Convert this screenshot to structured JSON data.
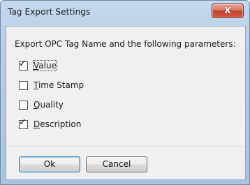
{
  "window": {
    "title": "Tag Export Settings",
    "close_glyph": "X"
  },
  "dialog": {
    "description": "Export OPC Tag Name and the following parameters:",
    "options": [
      {
        "label_prefix": "",
        "mnemonic": "V",
        "label_rest": "alue",
        "checked": true
      },
      {
        "label_prefix": "",
        "mnemonic": "T",
        "label_rest": "ime Stamp",
        "checked": false
      },
      {
        "label_prefix": "",
        "mnemonic": "Q",
        "label_rest": "uality",
        "checked": false
      },
      {
        "label_prefix": "",
        "mnemonic": "D",
        "label_rest": "escription",
        "checked": true
      }
    ],
    "check_glyph": "✓"
  },
  "buttons": {
    "ok_label": "Ok",
    "cancel_label": "Cancel"
  },
  "colors": {
    "title_gradient_top": "#c4d8ee",
    "close_button_red": "#c4432d",
    "client_background": "#f0f0f0",
    "default_button_border": "#3c7fb1"
  }
}
